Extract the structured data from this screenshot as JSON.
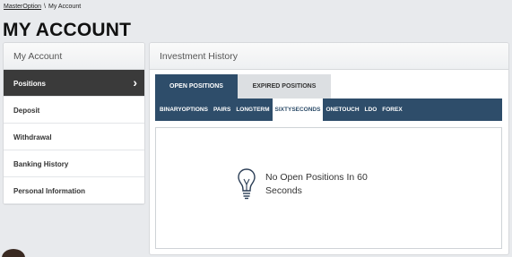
{
  "breadcrumb": {
    "home": "MasterOption",
    "separator": "\\",
    "current": "My Account"
  },
  "page_title": "MY ACCOUNT",
  "sidebar": {
    "header": "My Account",
    "items": [
      {
        "label": "Positions",
        "active": true
      },
      {
        "label": "Deposit"
      },
      {
        "label": "Withdrawal"
      },
      {
        "label": "Banking History"
      },
      {
        "label": "Personal Information"
      }
    ]
  },
  "main": {
    "header": "Investment History",
    "tabs": [
      {
        "label": "OPEN POSITIONS",
        "active": true
      },
      {
        "label": "EXPIRED POSITIONS"
      }
    ],
    "subtabs": [
      {
        "label": "BINARYOPTIONS"
      },
      {
        "label": "PAIRS"
      },
      {
        "label": "LONGTERM"
      },
      {
        "label": "SIXTYSECONDS",
        "active": true
      },
      {
        "label": "ONETOUCH"
      },
      {
        "label": "LDO"
      },
      {
        "label": "FOREX"
      }
    ],
    "empty_message": "No Open Positions In 60 Seconds",
    "empty_icon": "lightbulb-icon"
  },
  "colors": {
    "nav_active": "#3a3a3a",
    "tab_active": "#2e4d6a",
    "tab_inactive": "#dcdfe2"
  }
}
